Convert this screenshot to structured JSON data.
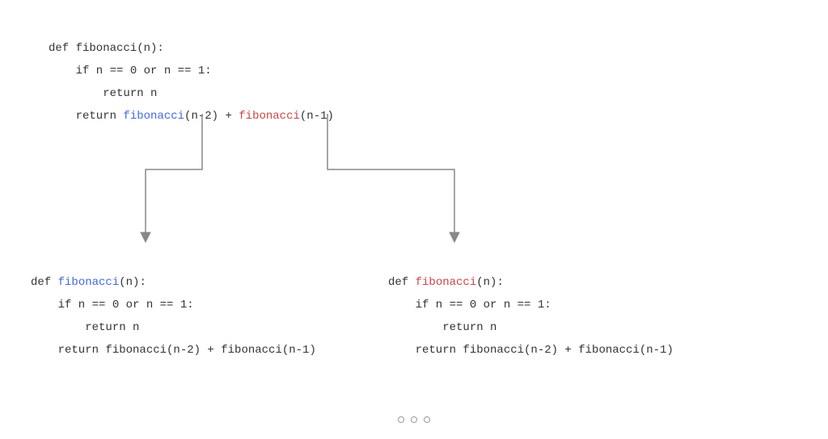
{
  "code": {
    "line1a": "def fibonacci(n):",
    "line2": "    if n == 0 or n == 1:",
    "line3": "        return n",
    "line4a": "    return ",
    "line4b": "fibonacci",
    "line4c": "(n-2) + ",
    "line4d": "fibonacci",
    "line4e": "(n-1)"
  },
  "bottom": {
    "defPrefix": "def ",
    "funcName": "fibonacci",
    "defSuffix": "(n):",
    "line2": "    if n == 0 or n == 1:",
    "line3": "        return n",
    "line4": "    return fibonacci(n-2) + fibonacci(n-1)"
  },
  "colors": {
    "blue": "#4169e1",
    "red": "#cc4444",
    "arrow": "#888888"
  }
}
